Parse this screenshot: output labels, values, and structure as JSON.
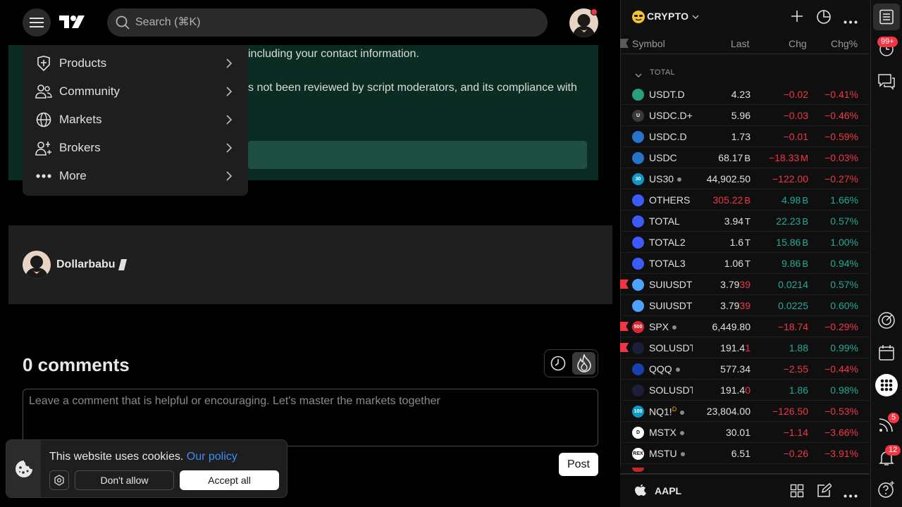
{
  "header": {
    "search_placeholder": "Search (⌘K)"
  },
  "article": {
    "line1": "including your contact information.",
    "line2": "s not been reviewed by script moderators, and its compliance with"
  },
  "dropdown": {
    "items": [
      {
        "label": "Products",
        "icon": "products-icon"
      },
      {
        "label": "Community",
        "icon": "community-icon"
      },
      {
        "label": "Markets",
        "icon": "globe-icon"
      },
      {
        "label": "Brokers",
        "icon": "brokers-icon"
      },
      {
        "label": "More",
        "icon": "more-icon"
      }
    ]
  },
  "author": {
    "name": "Dollarbabu"
  },
  "comments": {
    "title": "0 comments",
    "placeholder": "Leave a comment that is helpful or encouraging. Let's master the markets together",
    "post_label": "Post"
  },
  "cookie": {
    "text": "This website uses cookies.",
    "link": "Our policy",
    "deny": "Don't allow",
    "accept": "Accept all"
  },
  "watchlist": {
    "title": "CRYPTO",
    "columns": {
      "symbol": "Symbol",
      "last": "Last",
      "chg": "Chg",
      "chgp": "Chg%"
    },
    "section": "TOTAL",
    "rows": [
      {
        "sym": "USDT.D",
        "last": "4.23",
        "chg": "−0.02",
        "chgp": "−0.41%",
        "dir": "neg",
        "logo": "#26a17b",
        "logo_text": "",
        "flag": false,
        "dot": false
      },
      {
        "sym": "USDC.D+",
        "last": "5.96",
        "chg": "−0.03",
        "chgp": "−0.46%",
        "dir": "neg",
        "logo": "#3a3a3a",
        "logo_text": "U",
        "flag": false,
        "dot": false
      },
      {
        "sym": "USDC.D",
        "last": "1.73",
        "chg": "−0.01",
        "chgp": "−0.59%",
        "dir": "neg",
        "logo": "#2775ca",
        "logo_text": "",
        "flag": false,
        "dot": false
      },
      {
        "sym": "USDC",
        "last_main": "68.17",
        "last_suf": "B",
        "chg_main": "−18.33",
        "chg_suf": "M",
        "chgp": "−0.03%",
        "dir": "neg",
        "logo": "#2775ca",
        "logo_text": "",
        "flag": false,
        "dot": false
      },
      {
        "sym": "US30",
        "last": "44,902.50",
        "chg": "−122.00",
        "chgp": "−0.27%",
        "dir": "neg",
        "logo": "#0d9ac9",
        "logo_text": "30",
        "flag": false,
        "dot": true
      },
      {
        "sym": "OTHERS",
        "last_main": "305.22",
        "last_suf": "B",
        "chg_main": "4.98",
        "chg_suf": "B",
        "chgp": "1.66%",
        "dir": "pos",
        "logo": "#3d5afe",
        "logo_text": "",
        "flag": false,
        "dot": false,
        "last_color": "neg"
      },
      {
        "sym": "TOTAL",
        "last_main": "3.94",
        "last_suf": "T",
        "chg_main": "22.23",
        "chg_suf": "B",
        "chgp": "0.57%",
        "dir": "pos",
        "logo": "#3d5afe",
        "logo_text": "",
        "flag": false,
        "dot": false
      },
      {
        "sym": "TOTAL2",
        "last_main": "1.6",
        "last_suf": "T",
        "chg_main": "15.86",
        "chg_suf": "B",
        "chgp": "1.00%",
        "dir": "pos",
        "logo": "#3d5afe",
        "logo_text": "",
        "flag": false,
        "dot": false
      },
      {
        "sym": "TOTAL3",
        "last_main": "1.06",
        "last_suf": "T",
        "chg_main": "9.86",
        "chg_suf": "B",
        "chgp": "0.94%",
        "dir": "pos",
        "logo": "#3d5afe",
        "logo_text": "",
        "flag": false,
        "dot": false
      },
      {
        "sym": "SUIUSDT",
        "last_main": "3.79",
        "last_tail": "39",
        "chg": "0.0214",
        "chgp": "0.57%",
        "dir": "pos",
        "logo": "#4da2ff",
        "logo_text": "",
        "flag": true,
        "dot": false
      },
      {
        "sym": "SUIUSDT",
        "last_main": "3.79",
        "last_tail": "39",
        "chg": "0.0225",
        "chgp": "0.60%",
        "dir": "pos",
        "logo": "#4da2ff",
        "logo_text": "",
        "flag": false,
        "dot": false
      },
      {
        "sym": "SPX",
        "last": "6,449.80",
        "chg": "−18.74",
        "chgp": "−0.29%",
        "dir": "neg",
        "logo": "#e0262f",
        "logo_text": "500",
        "flag": true,
        "dot": true
      },
      {
        "sym": "SOLUSDT",
        "last_main": "191.4",
        "last_tail": "1",
        "chg": "1.88",
        "chgp": "0.99%",
        "dir": "pos",
        "logo": "#1b1f3b",
        "logo_text": "",
        "flag": true,
        "dot": false
      },
      {
        "sym": "QQQ",
        "last": "577.34",
        "chg": "−2.55",
        "chgp": "−0.44%",
        "dir": "neg",
        "logo": "#1a3fb0",
        "logo_text": "",
        "flag": false,
        "dot": true
      },
      {
        "sym": "SOLUSDT",
        "last_main": "191.4",
        "last_tail": "0",
        "chg": "1.86",
        "chgp": "0.98%",
        "dir": "pos",
        "logo": "#1b1f3b",
        "logo_text": "",
        "flag": false,
        "dot": false
      },
      {
        "sym": "NQ1!",
        "last": "23,804.00",
        "chg": "−126.50",
        "chgp": "−0.53%",
        "dir": "neg",
        "logo": "#0d9ac9",
        "logo_text": "100",
        "flag": false,
        "dot": true,
        "sup": "D"
      },
      {
        "sym": "MSTX",
        "last": "30.01",
        "chg": "−1.14",
        "chgp": "−3.66%",
        "dir": "neg",
        "logo": "#ffffff",
        "logo_text": "D",
        "flag": false,
        "dot": true
      },
      {
        "sym": "MSTU",
        "last": "6.51",
        "chg": "−0.26",
        "chgp": "−3.91%",
        "dir": "neg",
        "logo": "#ffffff",
        "logo_text": "REX",
        "flag": false,
        "dot": true
      }
    ],
    "bottom_symbol": "AAPL"
  },
  "sidebar": {
    "badge_alerts": "99+",
    "badge_feed": "5",
    "badge_notifications": "12"
  },
  "colors": {
    "neg": "#f23645",
    "pos": "#22ab94",
    "green_card": "#0b2c23"
  }
}
